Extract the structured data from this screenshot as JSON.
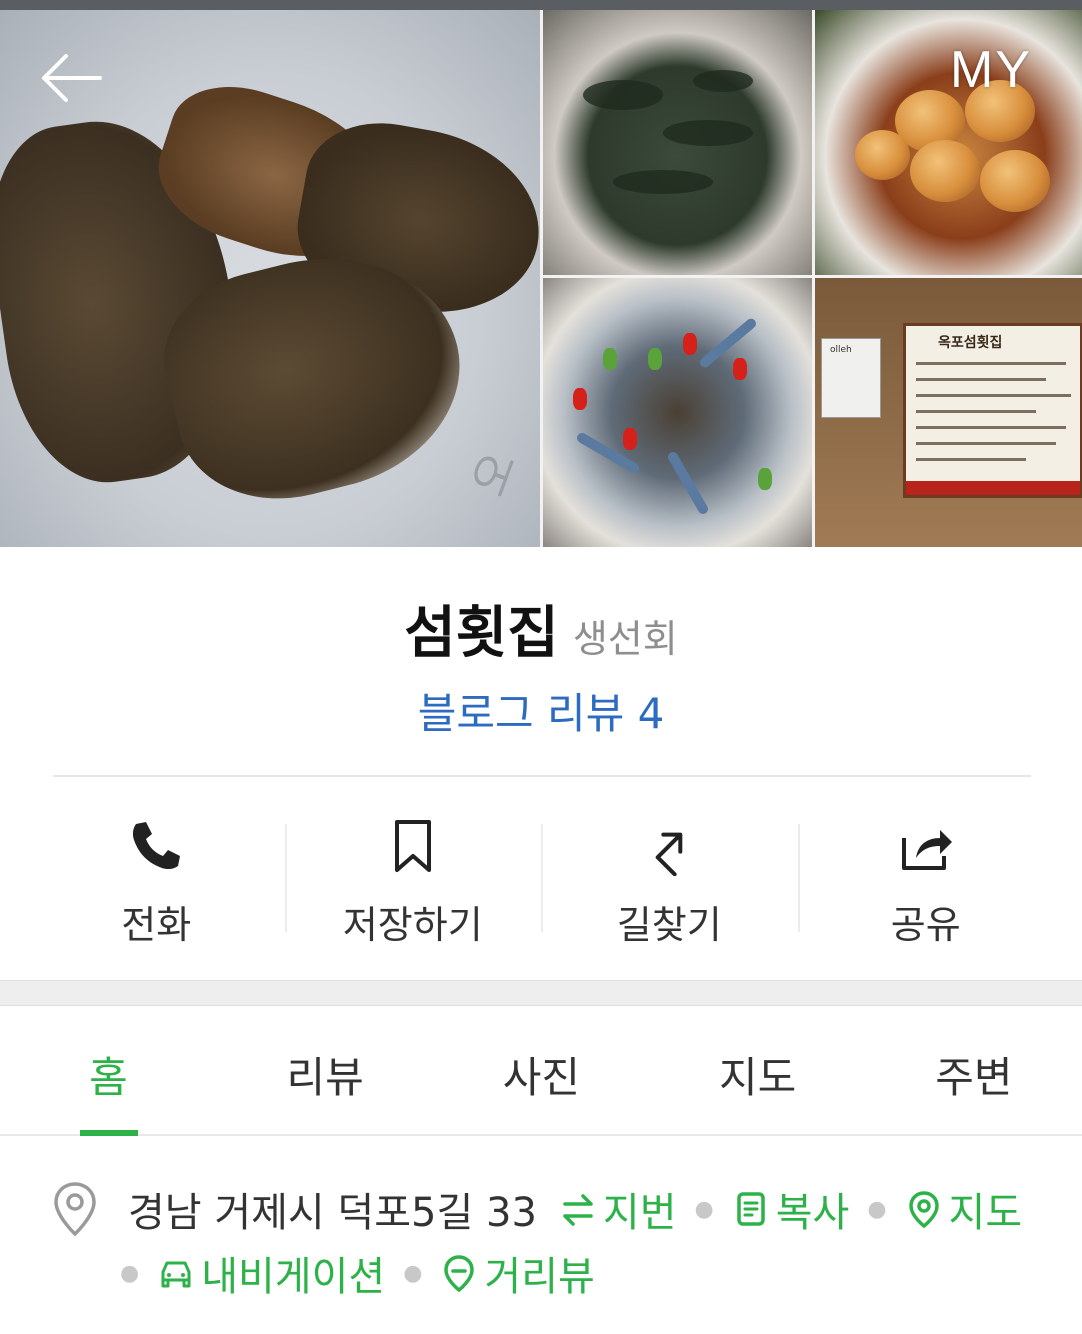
{
  "header": {
    "back_icon": "arrow-left-icon",
    "my_label": "MY"
  },
  "photos": {
    "menu_board_title": "옥포섬횟집",
    "menu_board_sign": "olleh"
  },
  "place": {
    "name": "섬횟집",
    "category": "생선회",
    "blog_review": "블로그 리뷰 4"
  },
  "actions": [
    {
      "label": "전화",
      "icon": "phone-icon"
    },
    {
      "label": "저장하기",
      "icon": "bookmark-icon"
    },
    {
      "label": "길찾기",
      "icon": "directions-icon"
    },
    {
      "label": "공유",
      "icon": "share-icon"
    }
  ],
  "tabs": [
    {
      "label": "홈",
      "active": true
    },
    {
      "label": "리뷰",
      "active": false
    },
    {
      "label": "사진",
      "active": false
    },
    {
      "label": "지도",
      "active": false
    },
    {
      "label": "주변",
      "active": false
    }
  ],
  "address": {
    "text": "경남 거제시 덕포5길 33",
    "links": {
      "lot_number": "지번",
      "copy": "복사",
      "map": "지도",
      "navigation": "내비게이션",
      "street_view": "거리뷰"
    }
  },
  "colors": {
    "accent_green": "#2db24a",
    "link_blue": "#2d6bc0"
  }
}
